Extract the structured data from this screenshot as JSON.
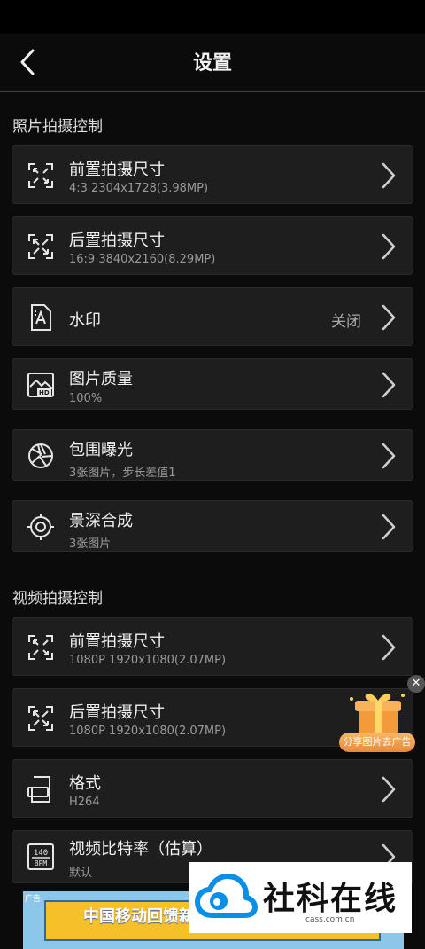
{
  "header": {
    "title": "设置"
  },
  "sections": {
    "photo": "照片拍摄控制",
    "video": "视频拍摄控制"
  },
  "photo_items": [
    {
      "title": "前置拍摄尺寸",
      "sub": "4:3  2304x1728(3.98MP)",
      "icon": "front-size-icon"
    },
    {
      "title": "后置拍摄尺寸",
      "sub": "16:9  3840x2160(8.29MP)",
      "icon": "rear-size-icon"
    },
    {
      "title": "水印",
      "value": "关闭",
      "icon": "watermark-icon"
    },
    {
      "title": "图片质量",
      "sub": "100%",
      "icon": "image-quality-icon"
    },
    {
      "title": "包围曝光",
      "sub": "3张图片，步长差值1",
      "icon": "aperture-icon"
    },
    {
      "title": "景深合成",
      "sub": "3张图片",
      "icon": "focus-target-icon"
    }
  ],
  "video_items": [
    {
      "title": "前置拍摄尺寸",
      "sub": "1080P  1920x1080(2.07MP)",
      "icon": "front-size-icon"
    },
    {
      "title": "后置拍摄尺寸",
      "sub": "1080P  1920x1080(2.07MP)",
      "icon": "rear-size-icon"
    },
    {
      "title": "格式",
      "sub": "H264",
      "icon": "format-icon"
    },
    {
      "title": "视频比特率（估算）",
      "sub": "默认",
      "icon": "bitrate-icon"
    }
  ],
  "bitrate_icon_text": {
    "top": "140",
    "bottom": "BPM"
  },
  "gift_overlay": {
    "label": "分享图片去广告",
    "close": "✕"
  },
  "ad_banner": {
    "text": "中国移动回馈新",
    "tag": "广告"
  },
  "watermark": {
    "name": "社科在线",
    "url": "cass.com.cn"
  },
  "colors": {
    "background": "#0b0b0b",
    "card": "#1e1e1e",
    "accent_blue": "#0a8fe8"
  }
}
